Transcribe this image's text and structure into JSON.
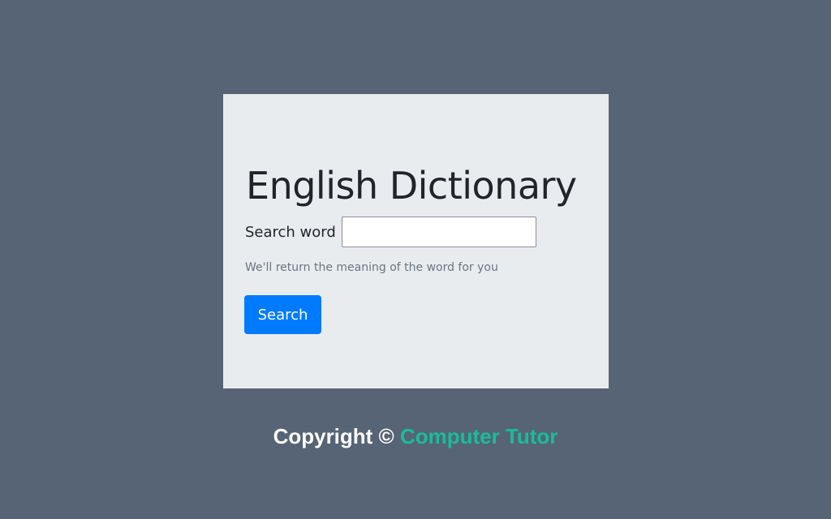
{
  "card": {
    "title": "English Dictionary",
    "search_label": "Search word",
    "search_value": "",
    "search_placeholder": "",
    "help_text": "We'll return the meaning of the word for you",
    "button_label": "Search"
  },
  "footer": {
    "prefix": "Copyright © ",
    "link_text": "Computer Tutor"
  },
  "colors": {
    "page_background": "#566475",
    "card_background": "#e9ecef",
    "button_primary": "#007bff",
    "link_accent": "#1abc9c",
    "muted_text": "#6c757d"
  }
}
